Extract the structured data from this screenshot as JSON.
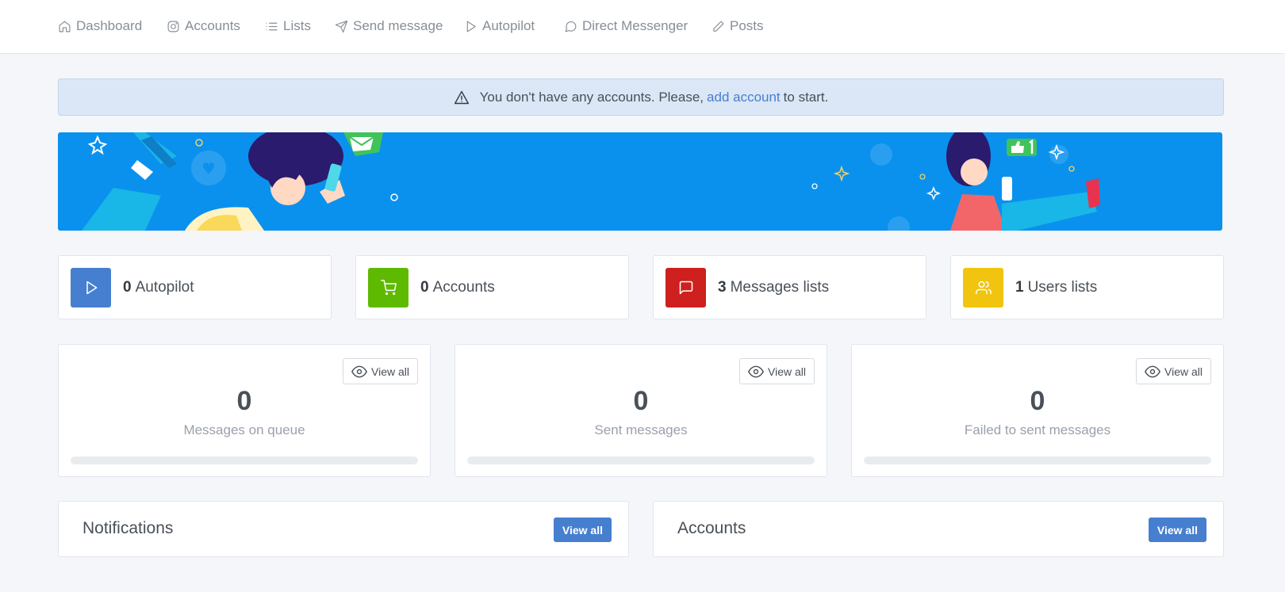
{
  "nav": {
    "items": [
      {
        "label": "Dashboard",
        "icon": "home-icon"
      },
      {
        "label": "Accounts",
        "icon": "instagram-icon"
      },
      {
        "label": "Lists",
        "icon": "list-icon"
      },
      {
        "label": "Send message",
        "icon": "send-icon"
      },
      {
        "label": "Autopilot",
        "icon": "play-icon"
      },
      {
        "label": "Direct Messenger",
        "icon": "message-circle-icon"
      },
      {
        "label": "Posts",
        "icon": "edit-icon"
      }
    ]
  },
  "alert": {
    "icon": "alert-triangle-icon",
    "text_before": "You don't have any accounts. Please,",
    "link": "add account",
    "text_after": "to start."
  },
  "stats": [
    {
      "value": "0",
      "label": "Autopilot",
      "icon": "play-icon",
      "color": "#467fcf"
    },
    {
      "value": "0",
      "label": "Accounts",
      "icon": "shopping-cart-icon",
      "color": "#5eba00"
    },
    {
      "value": "3",
      "label": "Messages lists",
      "icon": "message-square-icon",
      "color": "#cd201f"
    },
    {
      "value": "1",
      "label": "Users lists",
      "icon": "users-icon",
      "color": "#f1c40f"
    }
  ],
  "metrics": [
    {
      "value": "0",
      "label": "Messages on queue",
      "button": "View all",
      "progress": 0
    },
    {
      "value": "0",
      "label": "Sent messages",
      "button": "View all",
      "progress": 0
    },
    {
      "value": "0",
      "label": "Failed to sent messages",
      "button": "View all",
      "progress": 0
    }
  ],
  "panels": [
    {
      "title": "Notifications",
      "button": "View all"
    },
    {
      "title": "Accounts",
      "button": "View all"
    }
  ],
  "colors": {
    "primary": "#467fcf",
    "banner": "#0a91ee",
    "alert_bg": "#dbe7f6"
  }
}
